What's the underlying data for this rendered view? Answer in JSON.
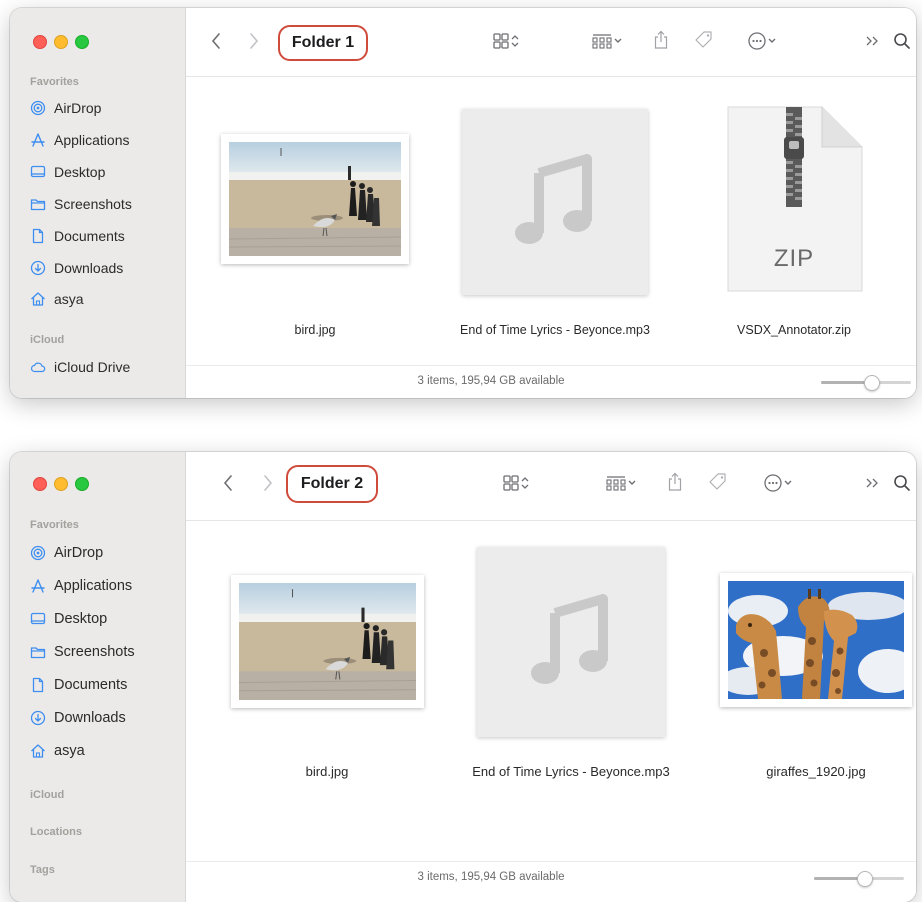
{
  "windows": [
    {
      "title": "Folder 1",
      "sidebar": {
        "favorites_label": "Favorites",
        "items": [
          {
            "label": "AirDrop",
            "icon": "airdrop-icon"
          },
          {
            "label": "Applications",
            "icon": "applications-icon"
          },
          {
            "label": "Desktop",
            "icon": "desktop-icon"
          },
          {
            "label": "Screenshots",
            "icon": "folder-icon"
          },
          {
            "label": "Documents",
            "icon": "document-icon"
          },
          {
            "label": "Downloads",
            "icon": "download-icon"
          },
          {
            "label": "asya",
            "icon": "home-icon"
          }
        ],
        "icloud_label": "iCloud",
        "icloud_items": [
          {
            "label": "iCloud Drive",
            "icon": "cloud-icon"
          }
        ]
      },
      "files": [
        {
          "name": "bird.jpg",
          "kind": "photo-beach"
        },
        {
          "name": "End of Time Lyrics - Beyonce.mp3",
          "kind": "audio"
        },
        {
          "name": "VSDX_Annotator.zip",
          "kind": "zip",
          "badge": "ZIP"
        }
      ],
      "status": "3 items, 195,94 GB available",
      "icon_size_level": 0.55
    },
    {
      "title": "Folder 2",
      "sidebar": {
        "favorites_label": "Favorites",
        "items": [
          {
            "label": "AirDrop",
            "icon": "airdrop-icon"
          },
          {
            "label": "Applications",
            "icon": "applications-icon"
          },
          {
            "label": "Desktop",
            "icon": "desktop-icon"
          },
          {
            "label": "Screenshots",
            "icon": "folder-icon"
          },
          {
            "label": "Documents",
            "icon": "document-icon"
          },
          {
            "label": "Downloads",
            "icon": "download-icon"
          },
          {
            "label": "asya",
            "icon": "home-icon"
          }
        ],
        "icloud_label": "iCloud",
        "locations_label": "Locations",
        "tags_label": "Tags"
      },
      "files": [
        {
          "name": "bird.jpg",
          "kind": "photo-beach"
        },
        {
          "name": "End of Time Lyrics - Beyonce.mp3",
          "kind": "audio"
        },
        {
          "name": "giraffes_1920.jpg",
          "kind": "photo-giraffes"
        }
      ],
      "status": "3 items, 195,94 GB available",
      "icon_size_level": 0.55
    }
  ],
  "colors": {
    "title_highlight": "#cf4b3b",
    "sidebar_icon": "#3d8ef0",
    "sidebar_bg": "#eceae8"
  }
}
